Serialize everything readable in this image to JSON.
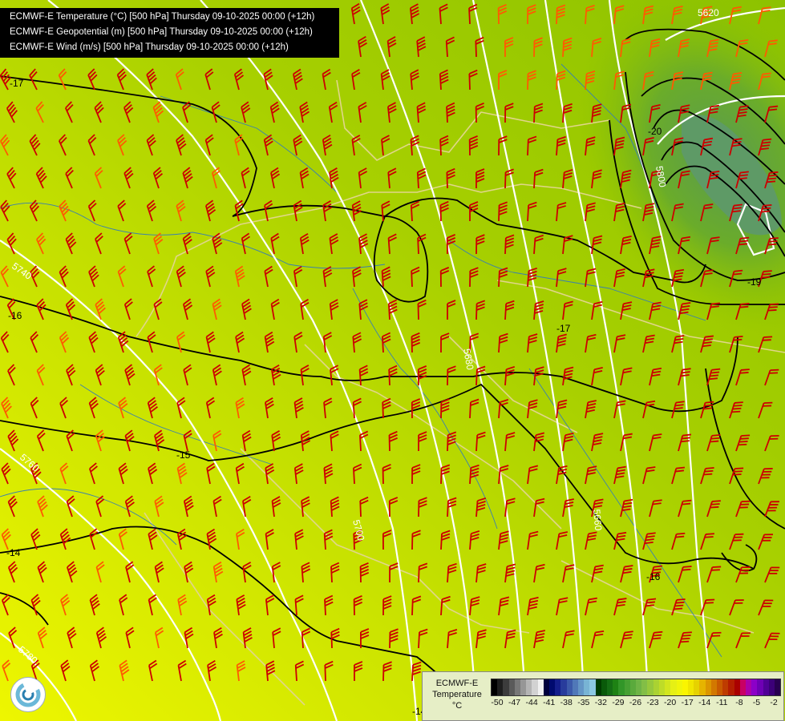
{
  "title_lines": [
    "ECMWF-E Temperature (°C) [500 hPa] Thursday 09-10-2025 00:00 (+12h)",
    "ECMWF-E Geopotential (m) [500 hPa] Thursday 09-10-2025 00:00 (+12h)",
    "ECMWF-E Wind (m/s) [500 hPa] Thursday 09-10-2025 00:00 (+12h)"
  ],
  "legend": {
    "name_line1": "ECMWF-E",
    "name_line2": "Temperature",
    "unit": "°C",
    "ticks": [
      "-50",
      "-47",
      "-44",
      "-41",
      "-38",
      "-35",
      "-32",
      "-29",
      "-26",
      "-23",
      "-20",
      "-17",
      "-14",
      "-11",
      "-8",
      "-5",
      "-2"
    ],
    "colors": [
      "#000000",
      "#1e1e1e",
      "#3c3c3c",
      "#5a5a5a",
      "#787878",
      "#969696",
      "#b4b4b4",
      "#d2d2d2",
      "#f0f0f0",
      "#00003c",
      "#000a6e",
      "#141e8c",
      "#283c9c",
      "#3c5aaa",
      "#5078b8",
      "#6496c6",
      "#78b4d4",
      "#8cc8e2",
      "#003c00",
      "#0a5a0a",
      "#146e14",
      "#1e8214",
      "#329628",
      "#46a032",
      "#5aaa3c",
      "#6eb446",
      "#82be46",
      "#96c83c",
      "#aad232",
      "#bedc28",
      "#d2e61e",
      "#e6f014",
      "#f0f50a",
      "#faf500",
      "#f0e600",
      "#e6d200",
      "#e6b400",
      "#dc9600",
      "#d27800",
      "#c85a00",
      "#be3c00",
      "#b41e00",
      "#aa0000",
      "#c80064",
      "#aa00aa",
      "#8c00c8",
      "#6e00b4",
      "#500096",
      "#3c0078",
      "#280050"
    ]
  },
  "isotherm_labels": [
    "-17",
    "-16",
    "-15",
    "-14",
    "-14",
    "-17",
    "-19",
    "-20",
    "-16"
  ],
  "geopotential_labels": [
    "5620",
    "5740",
    "5760",
    "5780",
    "5800",
    "5700",
    "5680",
    "5660"
  ],
  "colors": {
    "isotherm": "#000000",
    "geopotential": "#ffffff",
    "barb": "#cc0000",
    "border": "#e0d68a",
    "river": "#3a80b0",
    "legend_bg": "#e6eec6"
  }
}
